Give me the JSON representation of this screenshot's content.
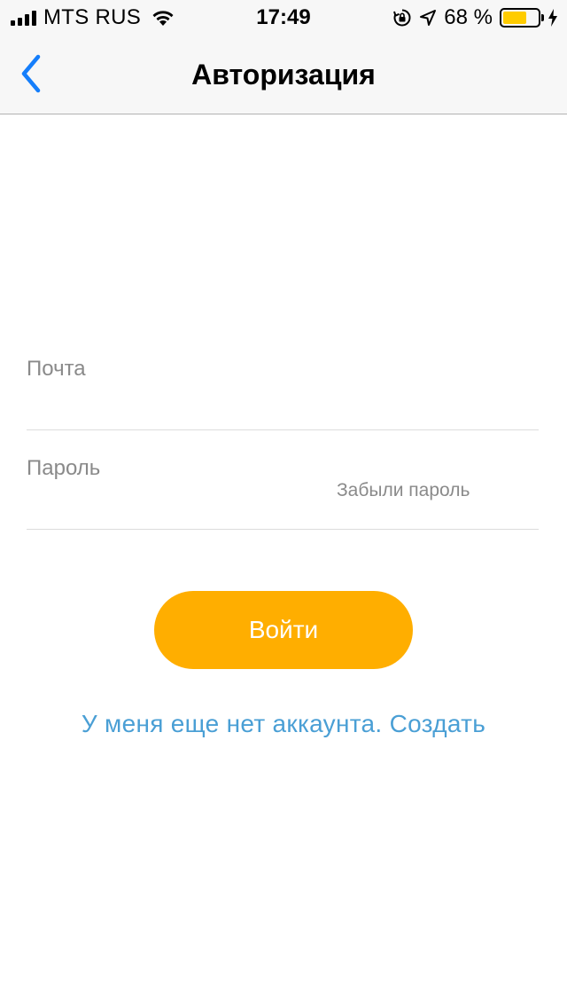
{
  "status_bar": {
    "carrier": "MTS RUS",
    "time": "17:49",
    "battery_percent": "68 %",
    "battery_level": 0.68,
    "icons": [
      "signal-icon",
      "wifi-icon",
      "orientation-lock-icon",
      "location-icon",
      "battery-icon",
      "charging-icon"
    ]
  },
  "nav": {
    "title": "Авторизация",
    "back_icon": "chevron-left-icon"
  },
  "form": {
    "email_label": "Почта",
    "email_value": "",
    "password_label": "Пароль",
    "password_value": "",
    "forgot_label": "Забыли пароль"
  },
  "actions": {
    "login_label": "Войти",
    "register_label": "У меня еще нет аккаунта. Создать"
  },
  "colors": {
    "accent": "#ffae00",
    "link": "#4a9fd5",
    "ios_blue": "#157efb",
    "battery": "#ffcc00"
  }
}
